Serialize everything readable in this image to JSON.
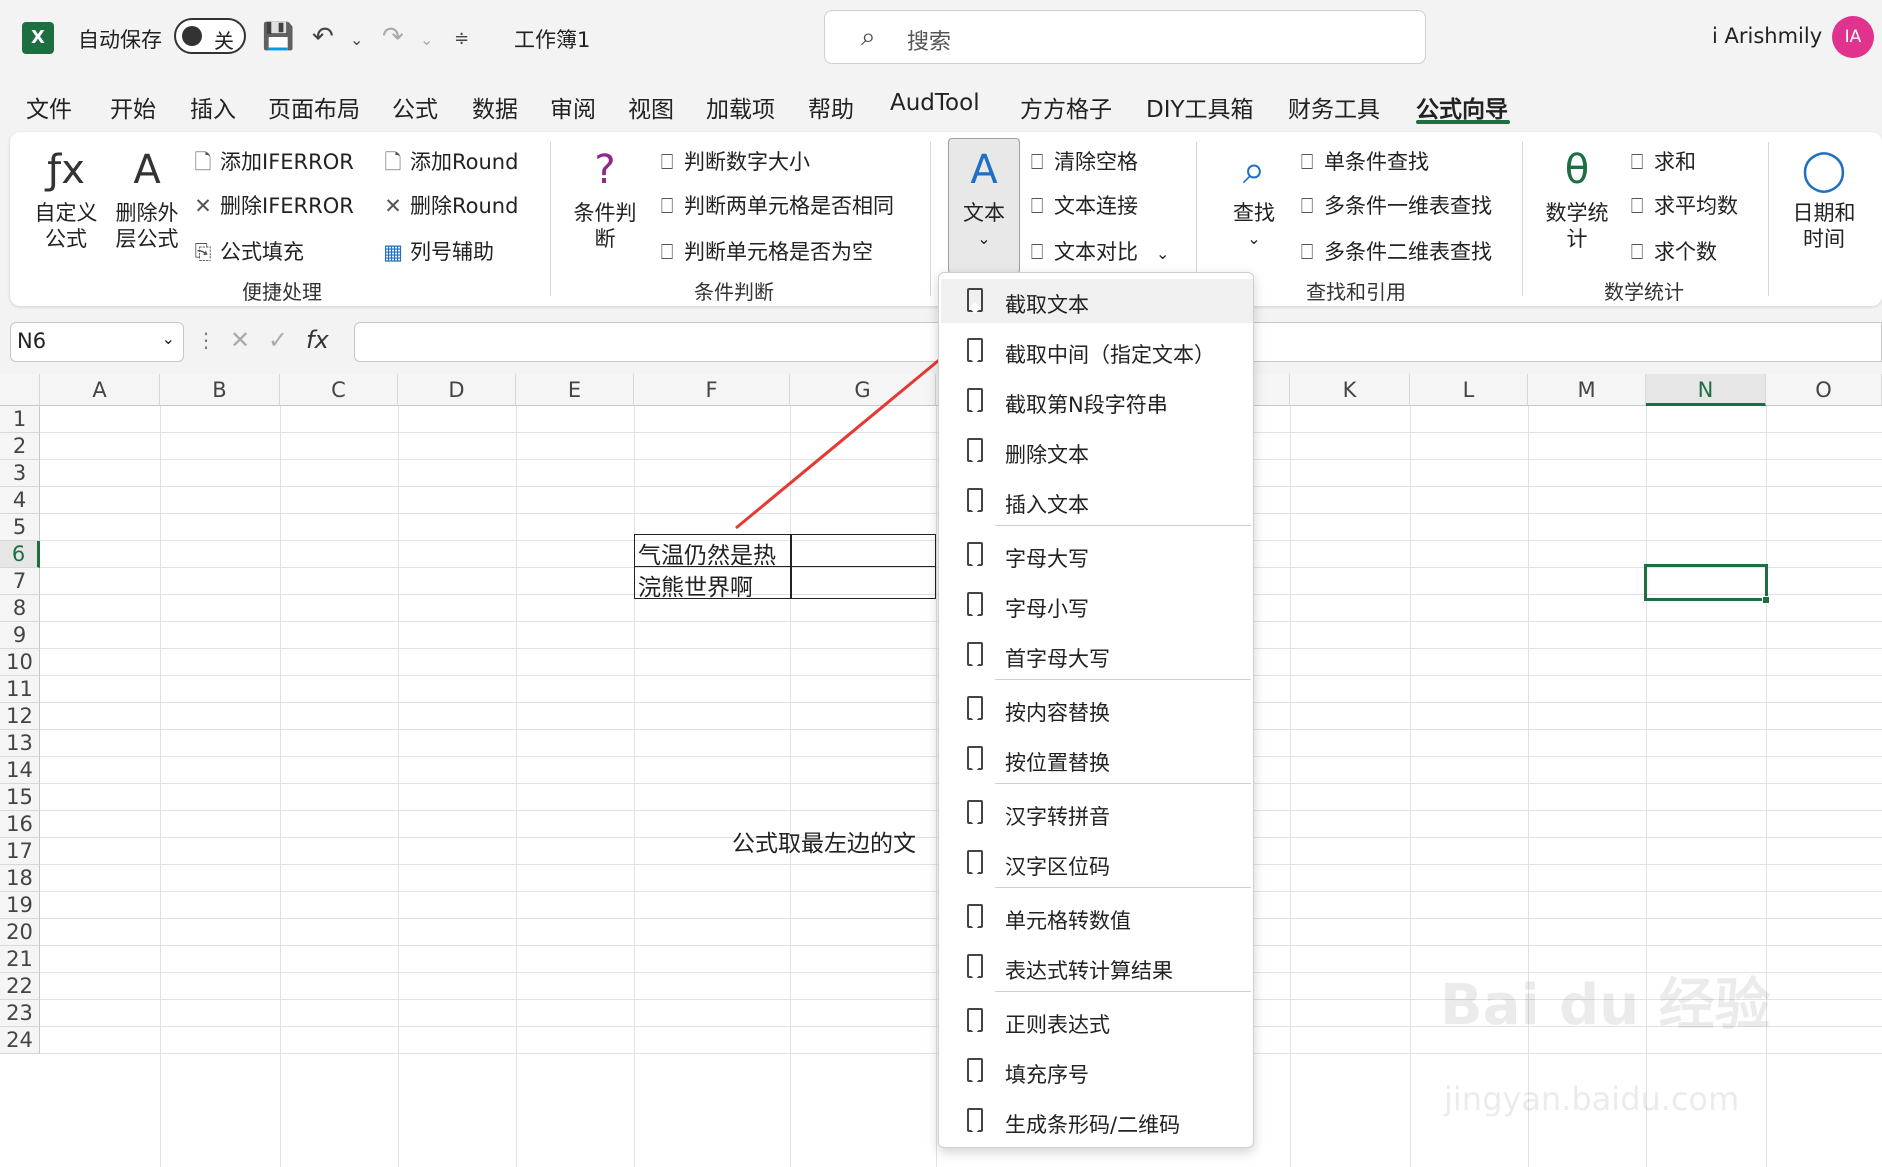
{
  "titlebar": {
    "autosave_label": "自动保存",
    "autosave_state": "关",
    "workbook_name": "工作簿1",
    "search_placeholder": "搜索",
    "user_name": "i Arishmily",
    "avatar_initials": "IA"
  },
  "tabs": [
    "文件",
    "开始",
    "插入",
    "页面布局",
    "公式",
    "数据",
    "审阅",
    "视图",
    "加载项",
    "帮助",
    "AudTool",
    "方方格子",
    "DIY工具箱",
    "财务工具",
    "公式向导"
  ],
  "active_tab": "公式向导",
  "ribbon": {
    "g1": {
      "custom_formula": "自定义\n公式",
      "delete_outer": "删除外\n层公式",
      "add_iferror": "添加IFERROR",
      "del_iferror": "删除IFERROR",
      "formula_fill": "公式填充",
      "add_round": "添加Round",
      "del_round": "删除Round",
      "col_helper": "列号辅助",
      "label": "便捷处理"
    },
    "g2": {
      "cond_judge": "条件判\n断",
      "judge_num_size": "判断数字大小",
      "judge_two_same": "判断两单元格是否相同",
      "judge_empty": "判断单元格是否为空",
      "label": "条件判断"
    },
    "g3": {
      "text": "文本",
      "clear_space": "清除空格",
      "text_concat": "文本连接",
      "text_compare": "文本对比"
    },
    "g4": {
      "find": "查找",
      "single_find": "单条件查找",
      "multi_1d": "多条件一维表查找",
      "multi_2d": "多条件二维表查找",
      "label": "查找和引用"
    },
    "g5": {
      "math_stat": "数学统\n计",
      "sum": "求和",
      "avg": "求平均数",
      "count": "求个数",
      "label": "数学统计"
    },
    "g6": {
      "datetime": "日期和\n时间"
    }
  },
  "formula_bar": {
    "namebox": "N6"
  },
  "columns": [
    "A",
    "B",
    "C",
    "D",
    "E",
    "F",
    "G",
    "K",
    "L",
    "M",
    "N",
    "O"
  ],
  "rows": [
    "1",
    "2",
    "3",
    "4",
    "5",
    "6",
    "7",
    "8",
    "9",
    "10",
    "11",
    "12",
    "13",
    "14",
    "15",
    "16",
    "17",
    "18",
    "19",
    "20",
    "21",
    "22",
    "23",
    "24"
  ],
  "cells": {
    "f5": "气温仍然是热",
    "f6": "浣熊世界啊",
    "f14": "公式取最左边的文"
  },
  "dropdown": {
    "items": [
      "截取文本",
      "截取中间（指定文本）",
      "截取第N段字符串",
      "删除文本",
      "插入文本",
      "字母大写",
      "字母小写",
      "首字母大写",
      "按内容替换",
      "按位置替换",
      "汉字转拼音",
      "汉字区位码",
      "单元格转数值",
      "表达式转计算结果",
      "正则表达式",
      "填充序号",
      "生成条形码/二维码"
    ]
  },
  "colors": {
    "accent": "#1d6f42",
    "arrow": "#e53935",
    "avatar": "#e0338e"
  },
  "watermark": {
    "line1": "Bai du 经验",
    "line2": "jingyan.baidu.com"
  }
}
